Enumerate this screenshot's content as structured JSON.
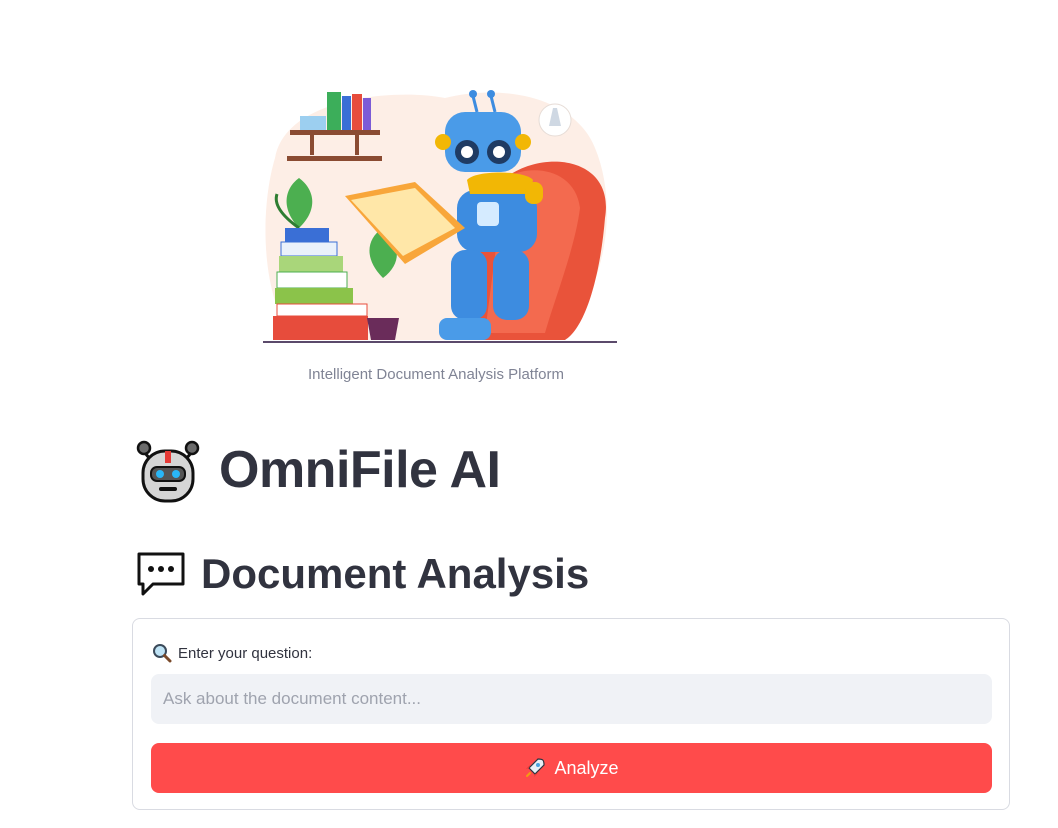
{
  "hero": {
    "caption": "Intelligent Document Analysis Platform",
    "icon": "robot-reading-illustration"
  },
  "header": {
    "title": "OmniFile AI",
    "title_icon": "robot-icon"
  },
  "section": {
    "title": "Document Analysis",
    "title_icon": "speech-bubble-icon"
  },
  "form": {
    "label": "Enter your question:",
    "label_icon": "magnifier-icon",
    "input_value": "",
    "input_placeholder": "Ask about the document content...",
    "button_label": "Analyze",
    "button_icon": "rocket-icon"
  },
  "colors": {
    "accent": "#ff4b4b",
    "input_bg": "#f0f2f6",
    "text": "#31333f",
    "caption": "#808495"
  }
}
